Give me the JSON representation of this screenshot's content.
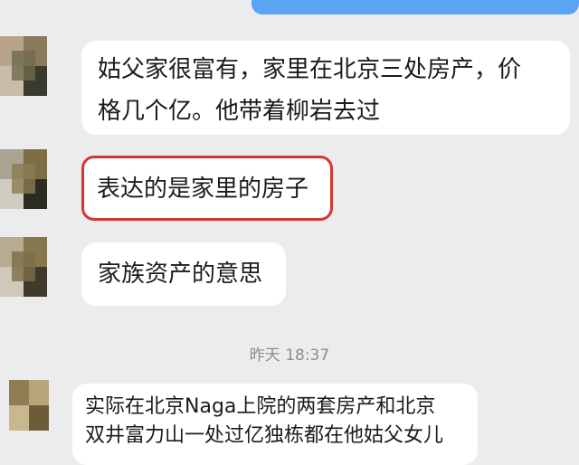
{
  "messages": {
    "m1_line1": "姑父家很富有，家里在北京三处房产，价",
    "m1_line2": "格几个亿。他带着柳岩去过",
    "m2": "表达的是家里的房子",
    "m3": "家族资产的意思",
    "timestamp": "昨天 18:37",
    "m4_line1": "实际在北京Naga上院的两套房产和北京",
    "m4_line2": "双井富力山一处过亿独栋都在他姑父女儿"
  },
  "colors": {
    "highlight_border": "#d8352f",
    "sent_bubble": "#5aa4f4",
    "background": "#ececef"
  }
}
